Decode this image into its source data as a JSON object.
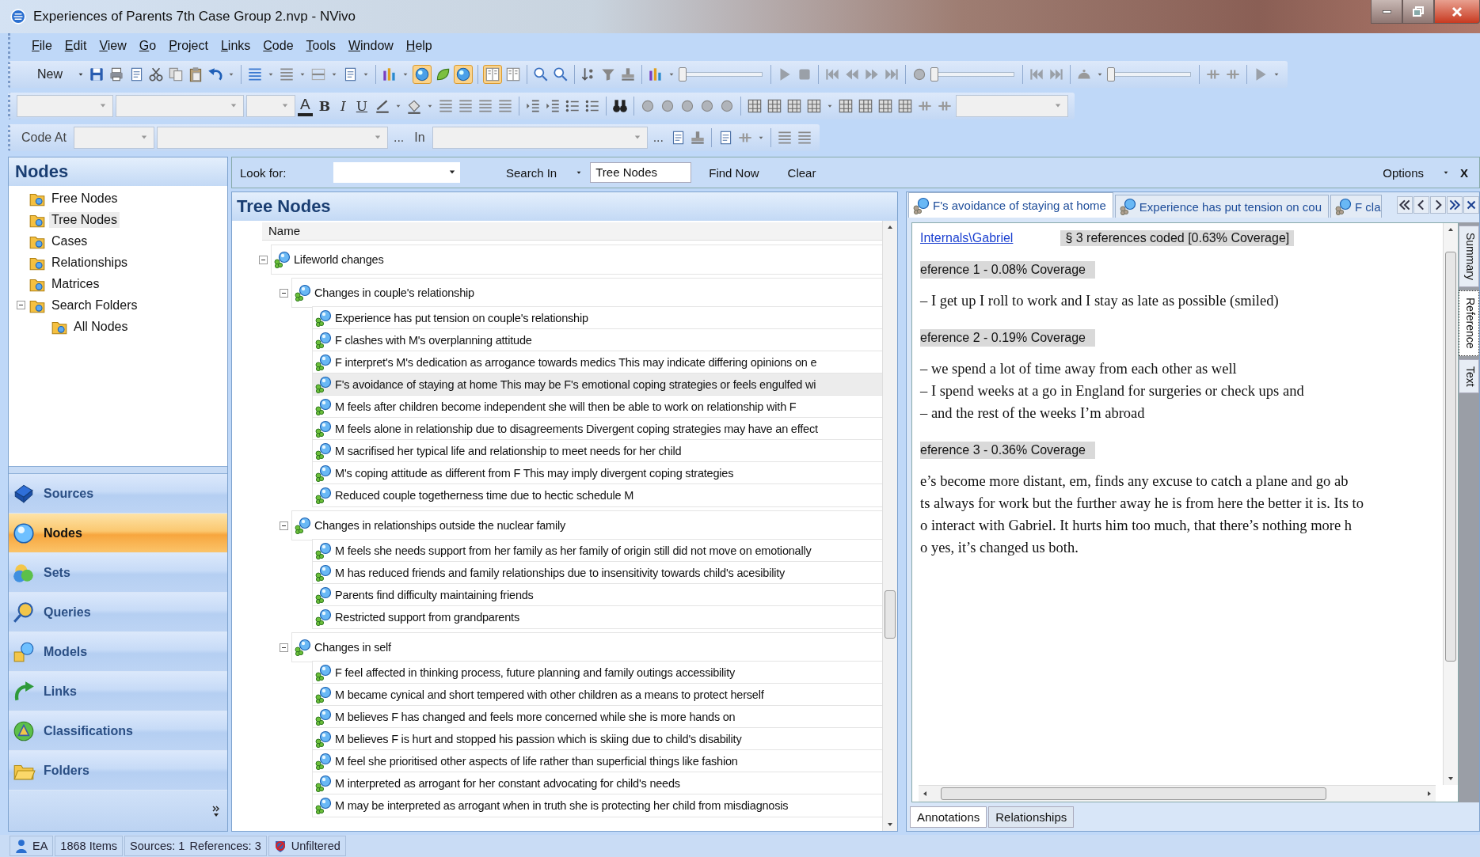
{
  "window": {
    "title": "Experiences of Parents 7th Case Group 2.nvp - NVivo"
  },
  "menu": [
    "File",
    "Edit",
    "View",
    "Go",
    "Project",
    "Links",
    "Code",
    "Tools",
    "Window",
    "Help"
  ],
  "toolbar": {
    "new_button": "New",
    "format_buttons": [
      {
        "label": "A",
        "kind": "color"
      },
      {
        "label": "B",
        "kind": "bold"
      },
      {
        "label": "I",
        "kind": "italic"
      },
      {
        "label": "U",
        "kind": "underline"
      }
    ],
    "sliders": [
      {
        "level": 0
      },
      {
        "level": 0
      },
      {
        "level": 0
      }
    ],
    "code_at_label": "Code At",
    "ellipsis_1": "...",
    "in_label": "In",
    "ellipsis_2": "..."
  },
  "navigation": {
    "title": "Nodes",
    "folders": [
      {
        "label": "Free Nodes",
        "selected": false
      },
      {
        "label": "Tree Nodes",
        "selected": true
      },
      {
        "label": "Cases",
        "selected": false
      },
      {
        "label": "Relationships",
        "selected": false
      },
      {
        "label": "Matrices",
        "selected": false
      },
      {
        "label": "Search Folders",
        "selected": false,
        "expanded": true,
        "children": [
          {
            "label": "All Nodes",
            "selected": false
          }
        ]
      }
    ],
    "buttons": [
      {
        "label": "Sources",
        "kind": "sources",
        "selected": false
      },
      {
        "label": "Nodes",
        "kind": "nodes",
        "selected": true
      },
      {
        "label": "Sets",
        "kind": "sets",
        "selected": false
      },
      {
        "label": "Queries",
        "kind": "queries",
        "selected": false
      },
      {
        "label": "Models",
        "kind": "models",
        "selected": false
      },
      {
        "label": "Links",
        "kind": "links",
        "selected": false
      },
      {
        "label": "Classifications",
        "kind": "classifications",
        "selected": false
      },
      {
        "label": "Folders",
        "kind": "folders",
        "selected": false
      }
    ]
  },
  "search_bar": {
    "look_for_label": "Look for:",
    "search_in": "Search In",
    "scope": "Tree Nodes",
    "find_now": "Find Now",
    "clear": "Clear",
    "options": "Options",
    "close": "X"
  },
  "list_view": {
    "title": "Tree Nodes",
    "column": "Name",
    "nodes": [
      {
        "name": "Lifeworld changes",
        "selected": false,
        "expanded": true,
        "children": [
          {
            "name": "Changes in couple's relationship",
            "selected": false,
            "expanded": true,
            "children": [
              {
                "name": "Experience has put tension on couple's relationship",
                "selected": false
              },
              {
                "name": "F clashes with M's overplanning attitude",
                "selected": false
              },
              {
                "name": "F interpret's M's dedication as arrogance towards medics This may indicate differing opinions on e",
                "selected": false
              },
              {
                "name": "F's avoidance of staying at home This may be F's emotional coping strategies or feels engulfed wi",
                "selected": true
              },
              {
                "name": "M feels after children become independent she will then be able to work on relationship with F",
                "selected": false
              },
              {
                "name": "M feels alone in relationship due to disagreements Divergent coping strategies may have an effect",
                "selected": false
              },
              {
                "name": "M sacrifised her typical life and relationship to meet needs for her child",
                "selected": false
              },
              {
                "name": "M's coping attitude as different from F This may imply divergent coping strategies",
                "selected": false
              },
              {
                "name": "Reduced couple togetherness time due to hectic schedule M",
                "selected": false
              }
            ]
          },
          {
            "name": "Changes in relationships outside the nuclear family",
            "selected": false,
            "expanded": true,
            "children": [
              {
                "name": "M feels she needs support from her family as her family of origin still did not move on emotionally",
                "selected": false
              },
              {
                "name": "M has reduced friends and family relationships due to insensitivity towards child's acesibility",
                "selected": false
              },
              {
                "name": "Parents find difficulty maintaining friends",
                "selected": false
              },
              {
                "name": "Restricted support from grandparents",
                "selected": false
              }
            ]
          },
          {
            "name": "Changes in self",
            "selected": false,
            "expanded": true,
            "children": [
              {
                "name": "F feel affected in thinking process, future planning and family outings accessibility",
                "selected": false
              },
              {
                "name": "M became cynical and short tempered with other children as a means to protect herself",
                "selected": false
              },
              {
                "name": "M believes F has changed and feels more concerned while she is more hands on",
                "selected": false
              },
              {
                "name": "M believes F is hurt and stopped his passion which is skiing due to child's disability",
                "selected": false
              },
              {
                "name": "M feel she prioritised other aspects of life rather than superficial things like fashion",
                "selected": false
              },
              {
                "name": "M interpreted as arrogant for her constant advocating for child's needs",
                "selected": false
              },
              {
                "name": "M may be interpreted as arrogant when in truth she is protecting her child from misdiagnosis",
                "selected": false
              }
            ]
          }
        ]
      }
    ]
  },
  "detail_view": {
    "tabs": [
      {
        "label": "F's avoidance of staying at home",
        "selected": true
      },
      {
        "label": "Experience has put tension on cou",
        "selected": false
      },
      {
        "label": "F cla",
        "selected": false
      }
    ],
    "source_link": "Internals\\Gabriel",
    "summary": "§ 3 references coded  [0.63% Coverage]",
    "blocks": [
      {
        "kind": "reference",
        "text": "eference 1 - 0.08% Coverage"
      },
      {
        "kind": "passage",
        "lines": [
          "– I get up I roll to work and I stay as late as possible (smiled)"
        ]
      },
      {
        "kind": "reference",
        "text": "eference 2 - 0.19% Coverage"
      },
      {
        "kind": "passage",
        "lines": [
          "– we spend a lot of time away from each other as well",
          "– I spend weeks at a go in England for surgeries or check ups and",
          "– and the rest of the weeks I’m abroad"
        ]
      },
      {
        "kind": "reference",
        "text": "eference 3 - 0.36% Coverage"
      },
      {
        "kind": "passage",
        "lines": [
          "e’s become more distant, em, finds any excuse to catch a plane and go ab",
          "ts always for work but the further away he is from here the better it is. Its to",
          "o interact with Gabriel. It hurts him too much, that there’s nothing more h",
          "o yes, it’s changed us both."
        ]
      }
    ],
    "side_tabs": [
      {
        "label": "Summary",
        "selected": false
      },
      {
        "label": "Reference",
        "selected": true
      },
      {
        "label": "Text",
        "selected": false
      }
    ],
    "bottom_tabs": [
      {
        "label": "Annotations",
        "selected": true
      },
      {
        "label": "Relationships",
        "selected": false
      }
    ]
  },
  "status_bar": {
    "user": "EA",
    "items": "1868 Items",
    "sources": "Sources: 1",
    "references": "References: 3",
    "filter": "Unfiltered"
  }
}
